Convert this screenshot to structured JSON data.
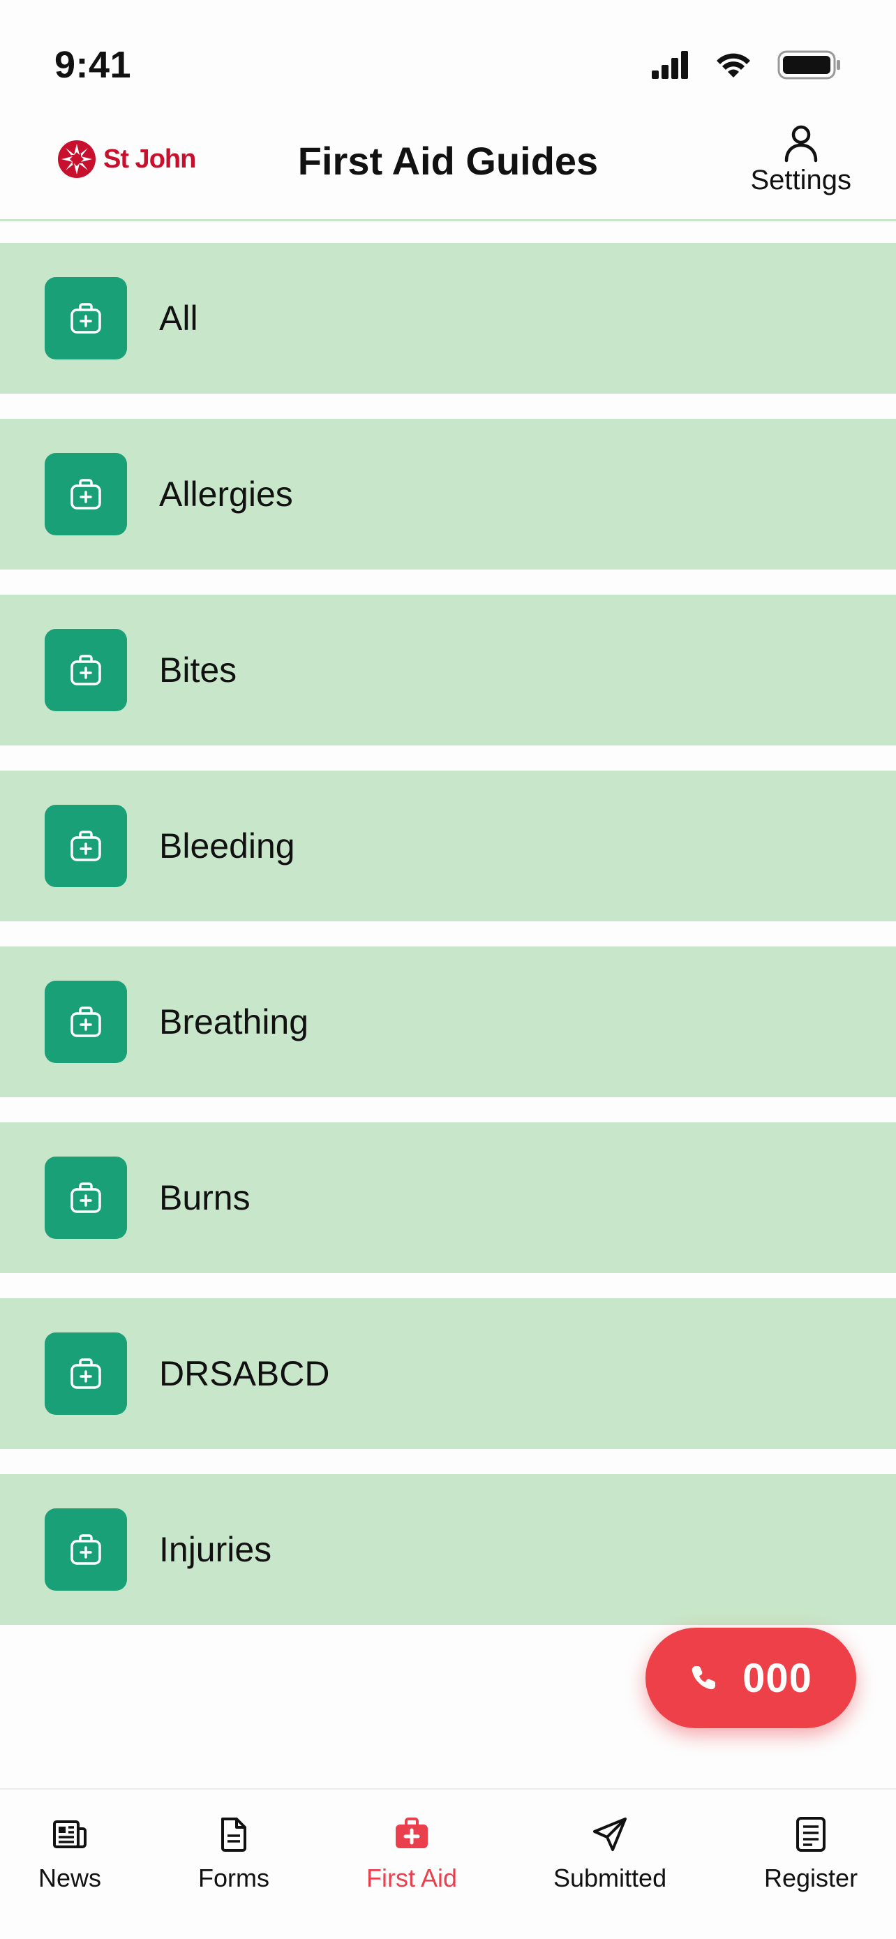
{
  "status_bar": {
    "time": "9:41"
  },
  "header": {
    "logo_text": "St John",
    "title": "First Aid Guides",
    "settings_label": "Settings"
  },
  "guides": [
    {
      "label": "All",
      "icon": "medical-kit-icon"
    },
    {
      "label": "Allergies",
      "icon": "medical-kit-icon"
    },
    {
      "label": "Bites",
      "icon": "medical-kit-icon"
    },
    {
      "label": "Bleeding",
      "icon": "medical-kit-icon"
    },
    {
      "label": "Breathing",
      "icon": "medical-kit-icon"
    },
    {
      "label": "Burns",
      "icon": "medical-kit-icon"
    },
    {
      "label": "DRSABCD",
      "icon": "medical-kit-icon"
    },
    {
      "label": "Injuries",
      "icon": "medical-kit-icon"
    }
  ],
  "call_button": {
    "label": "000",
    "icon": "phone-icon"
  },
  "bottom_nav": {
    "items": [
      {
        "label": "News",
        "icon": "news-icon",
        "active": false
      },
      {
        "label": "Forms",
        "icon": "document-icon",
        "active": false
      },
      {
        "label": "First Aid",
        "icon": "first-aid-icon",
        "active": true
      },
      {
        "label": "Submitted",
        "icon": "send-icon",
        "active": false
      },
      {
        "label": "Register",
        "icon": "register-icon",
        "active": false
      }
    ]
  },
  "colors": {
    "list_background": "#c8e6c9",
    "icon_background": "#19a077",
    "accent_red": "#ea3f4d",
    "logo_red": "#c8102e"
  }
}
